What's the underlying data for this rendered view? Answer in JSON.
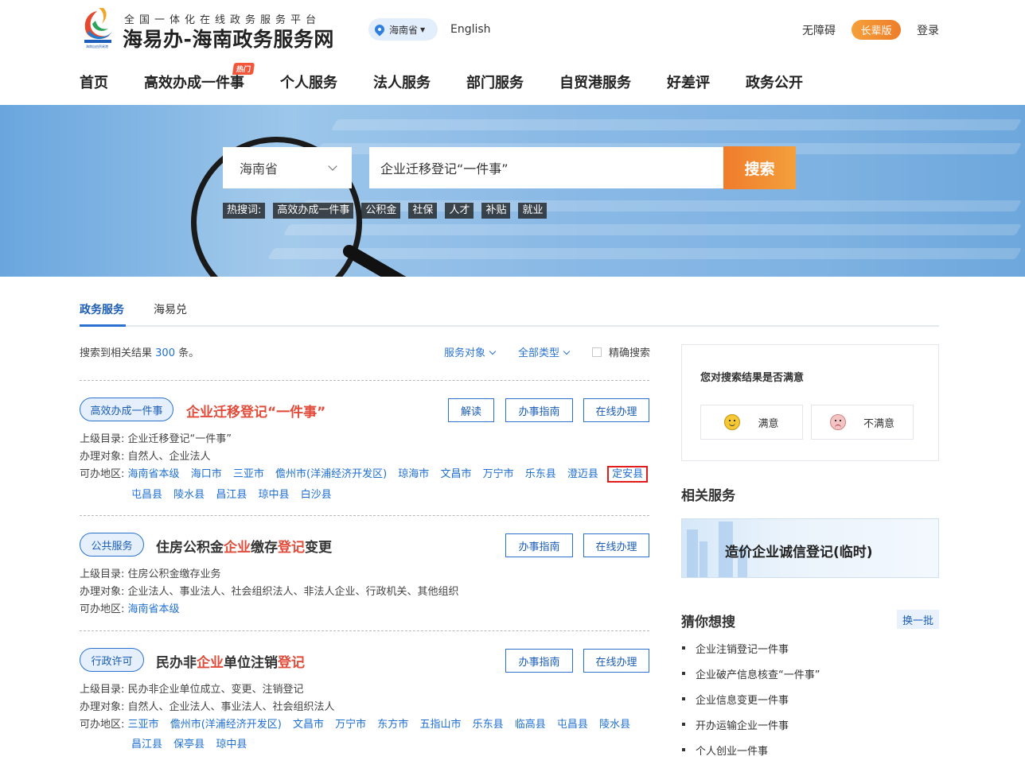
{
  "header": {
    "logo_caption": "海南自由贸易港",
    "logo_sub": "全国一体化在线政务服务平台",
    "logo_title": "海易办-海南政务服务网",
    "region": "海南省",
    "english": "English",
    "accessibility": "无障碍",
    "elder_mode": "长辈版",
    "login": "登录"
  },
  "nav": {
    "items": [
      "首页",
      "高效办成一件事",
      "个人服务",
      "法人服务",
      "部门服务",
      "自贸港服务",
      "好差评",
      "政务公开"
    ],
    "hot_tag": "热门"
  },
  "search": {
    "region": "海南省",
    "query": "企业迁移登记“一件事”",
    "button": "搜索",
    "hot_label": "热搜词:",
    "hot_words": [
      "高效办成一件事",
      "公积金",
      "社保",
      "人才",
      "补贴",
      "就业"
    ]
  },
  "tabs": [
    "政务服务",
    "海易兑"
  ],
  "results": {
    "summary_pre": "搜索到相关结果",
    "count": "300",
    "summary_post": "条。",
    "filter_target": "服务对象",
    "filter_type": "全部类型",
    "precise": "精确搜索",
    "labels": {
      "catalog": "上级目录:",
      "target": "办理对象:",
      "region": "可办地区:"
    },
    "items": [
      {
        "tag": "高效办成一件事",
        "title": "企业迁移登记“一件事”",
        "buttons": [
          "解读",
          "办事指南",
          "在线办理"
        ],
        "catalog": "企业迁移登记“一件事”",
        "target": "自然人、企业法人",
        "regions_line1": [
          "海南省本级",
          "海口市",
          "三亚市",
          "儋州市(洋浦经济开发区)",
          "琼海市",
          "文昌市",
          "万宁市",
          "乐东县",
          "澄迈县",
          "定安县"
        ],
        "regions_line2": [
          "屯昌县",
          "陵水县",
          "昌江县",
          "琼中县",
          "白沙县"
        ]
      },
      {
        "tag": "公共服务",
        "title_parts": [
          "住房公积金",
          "企业",
          "缴存",
          "登记",
          "变更"
        ],
        "buttons": [
          "办事指南",
          "在线办理"
        ],
        "catalog": "住房公积金缴存业务",
        "target": "企业法人、事业法人、社会组织法人、非法人企业、行政机关、其他组织",
        "regions_line1": [
          "海南省本级"
        ]
      },
      {
        "tag": "行政许可",
        "title_parts": [
          "民办非",
          "企业",
          "单位注销",
          "登记"
        ],
        "buttons": [
          "办事指南",
          "在线办理"
        ],
        "catalog": "民办非企业单位成立、变更、注销登记",
        "target": "自然人、企业法人、事业法人、社会组织法人",
        "regions_line1": [
          "三亚市",
          "儋州市(洋浦经济开发区)",
          "文昌市",
          "万宁市",
          "东方市",
          "五指山市",
          "乐东县",
          "临高县",
          "屯昌县",
          "陵水县"
        ],
        "regions_line2": [
          "昌江县",
          "保亭县",
          "琼中县"
        ]
      }
    ]
  },
  "sidebar": {
    "satisfaction_q": "您对搜索结果是否满意",
    "satisfied": "满意",
    "unsatisfied": "不满意",
    "related_title": "相关服务",
    "related_card": "造价企业诚信登记(临时)",
    "guess_title": "猜你想搜",
    "swap": "换一批",
    "guess": [
      "企业注销登记一件事",
      "企业破产信息核查“一件事”",
      "企业信息变更一件事",
      "开办运输企业一件事",
      "个人创业一件事"
    ]
  },
  "colors": {
    "primary": "#2b72d0",
    "highlight": "#e24c3b",
    "orange": "#f07b2c"
  }
}
